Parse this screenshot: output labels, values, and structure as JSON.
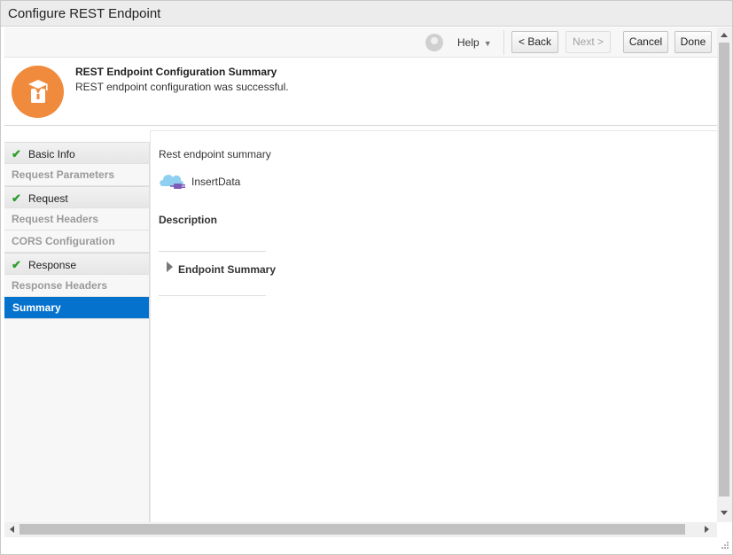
{
  "window": {
    "title": "Configure REST Endpoint"
  },
  "toolbar": {
    "user_icon": "user-avatar-icon",
    "help_label": "Help",
    "back_label": "<  Back",
    "next_label": "Next  >",
    "cancel_label": "Cancel",
    "done_label": "Done"
  },
  "summary": {
    "title": "REST Endpoint Configuration Summary",
    "message": "REST endpoint configuration was successful.",
    "badge_color": "#f08a3c"
  },
  "sidebar": {
    "items": [
      {
        "label": "Basic Info",
        "type": "group",
        "checked": true
      },
      {
        "label": "Request Parameters",
        "type": "sub"
      },
      {
        "label": "Request",
        "type": "group",
        "checked": true
      },
      {
        "label": "Request Headers",
        "type": "sub"
      },
      {
        "label": "CORS Configuration",
        "type": "sub"
      },
      {
        "label": "Response",
        "type": "group",
        "checked": true
      },
      {
        "label": "Response Headers",
        "type": "sub"
      },
      {
        "label": "Summary",
        "type": "active"
      }
    ],
    "active_color": "#0572ce",
    "check_color": "#2e9e2e"
  },
  "content": {
    "heading": "Rest endpoint summary",
    "endpoint_name": "InsertData",
    "endpoint_icon": "cloud-plug-icon",
    "description_label": "Description",
    "section_label": "Endpoint Summary"
  }
}
